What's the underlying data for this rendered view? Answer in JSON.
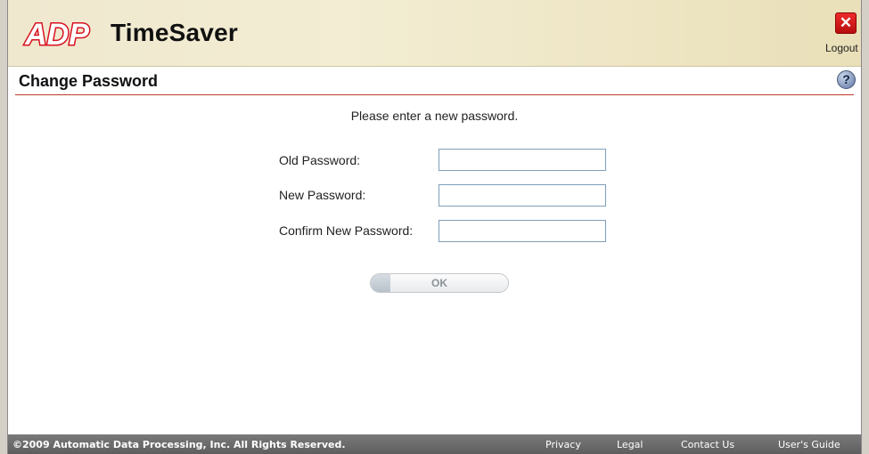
{
  "header": {
    "logo_text": "ADP",
    "app_title": "TimeSaver",
    "logout_label": "Logout"
  },
  "page": {
    "title": "Change Password",
    "instruction": "Please enter a new password."
  },
  "form": {
    "old_password_label": "Old Password:",
    "new_password_label": "New Password:",
    "confirm_password_label": "Confirm New Password:",
    "old_password_value": "",
    "new_password_value": "",
    "confirm_password_value": "",
    "ok_label": "OK"
  },
  "footer": {
    "copyright": "©2009 Automatic Data Processing, Inc. All Rights Reserved.",
    "links": [
      "Privacy",
      "Legal",
      "Contact Us",
      "User's Guide"
    ]
  },
  "colors": {
    "accent_red": "#d8111f",
    "rule_red": "#c0392b",
    "footer_gray": "#6b6b6b",
    "header_tan": "#efe8cf"
  }
}
